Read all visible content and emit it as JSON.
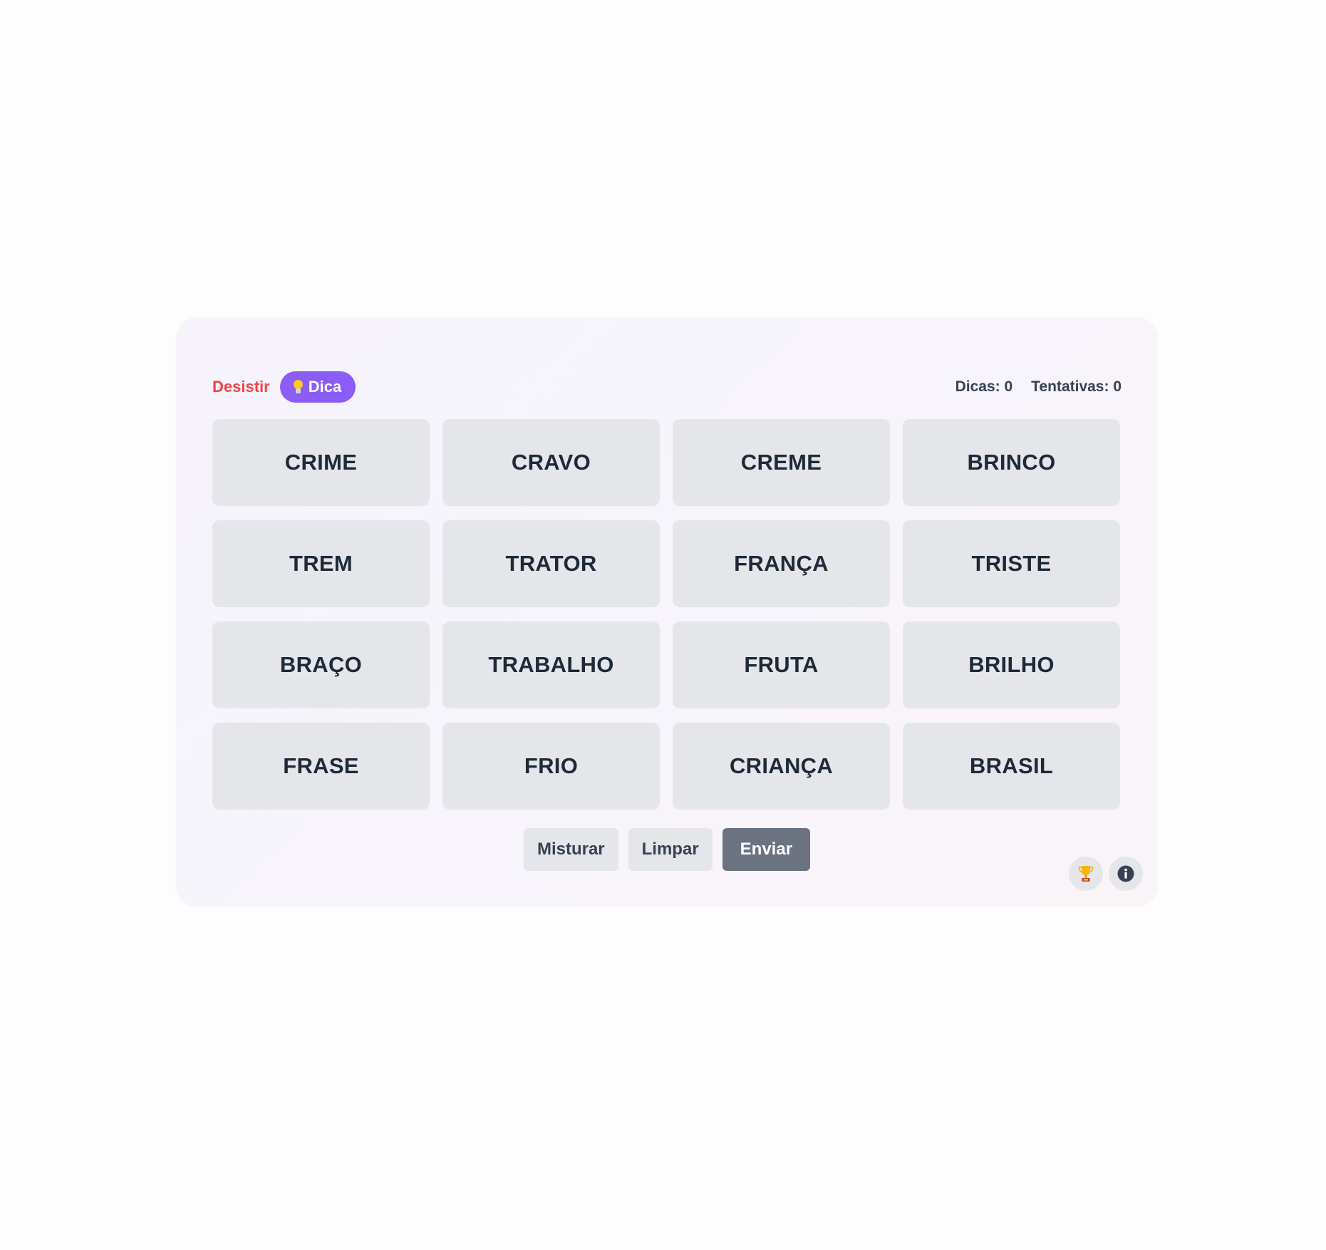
{
  "header": {
    "give_up_label": "Desistir",
    "hint_label": "Dica",
    "hint_icon": "lightbulb-icon",
    "hints_used": "Dicas: 0",
    "attempts": "Tentativas: 0"
  },
  "tiles": [
    "CRIME",
    "CRAVO",
    "CREME",
    "BRINCO",
    "TREM",
    "TRATOR",
    "FRANÇA",
    "TRISTE",
    "BRAÇO",
    "TRABALHO",
    "FRUTA",
    "BRILHO",
    "FRASE",
    "FRIO",
    "CRIANÇA",
    "BRASIL"
  ],
  "actions": {
    "shuffle_label": "Misturar",
    "clear_label": "Limpar",
    "submit_label": "Enviar"
  },
  "corner_buttons": {
    "trophy_icon": "trophy-icon",
    "info_icon": "info-icon"
  },
  "colors": {
    "give_up": "#ef4444",
    "hint_accent": "#8b5cf6",
    "tile_bg": "#e5e6ea",
    "tile_text": "#1f2937",
    "submit_bg": "#6b7280"
  }
}
